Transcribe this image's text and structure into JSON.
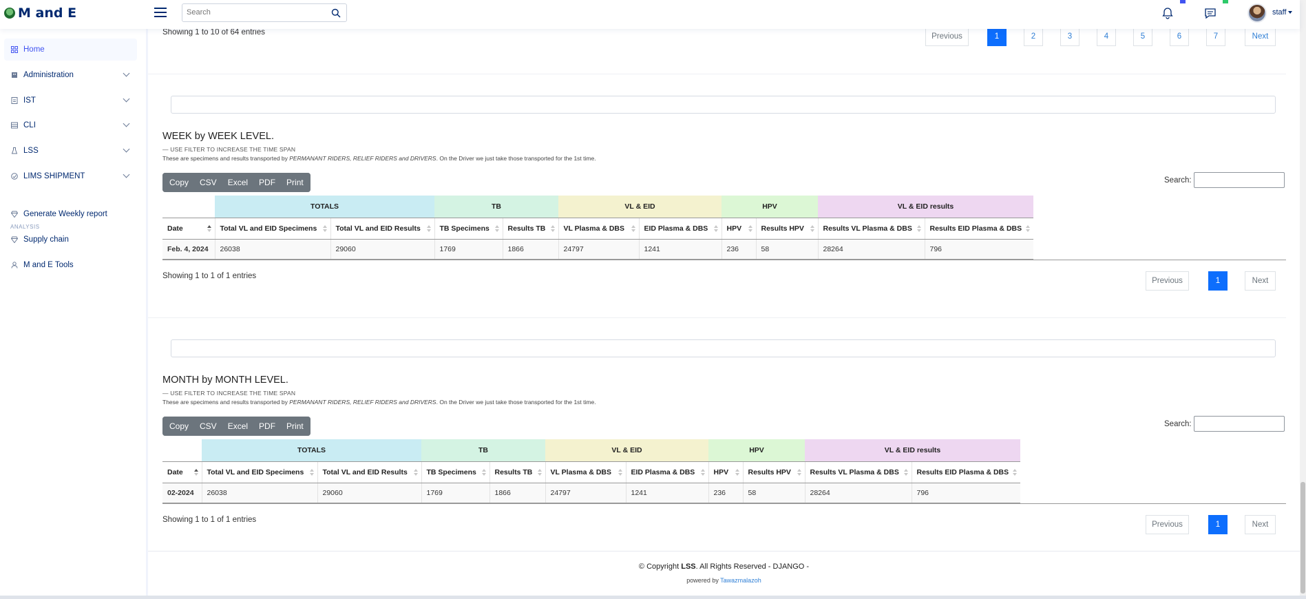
{
  "app": {
    "title": "M and E"
  },
  "header": {
    "search_placeholder": "Search",
    "user": "staff"
  },
  "sidebar": {
    "items": [
      {
        "label": "Home",
        "icon": "grid-icon"
      },
      {
        "label": "Administration",
        "icon": "building-icon"
      },
      {
        "label": "IST",
        "icon": "document-icon"
      },
      {
        "label": "CLI",
        "icon": "list-icon"
      },
      {
        "label": "LSS",
        "icon": "flask-icon"
      },
      {
        "label": "LIMS SHIPMENT",
        "icon": "shipment-icon"
      }
    ],
    "heading": "ANALYSIS",
    "analysis_items": [
      {
        "label": "Generate Weekly report",
        "icon": "gem-icon"
      },
      {
        "label": "Supply chain",
        "icon": "gem-icon"
      },
      {
        "label": "M and E Tools",
        "icon": "person-icon"
      }
    ]
  },
  "top_pager": {
    "info": "Showing 1 to 10 of 64 entries",
    "previous": "Previous",
    "next": "Next",
    "pages": [
      "1",
      "2",
      "3",
      "4",
      "5",
      "6",
      "7"
    ]
  },
  "common": {
    "subtitle": "— USE FILTER TO INCREASE THE TIME SPAN",
    "desc_start": "These are specimens and results transported by ",
    "desc_em": "PERMANANT RIDERS, RELIEF RIDERS and DRIVERS",
    "desc_end": ". On the Driver we just take those transported for the 1st time.",
    "buttons": [
      "Copy",
      "CSV",
      "Excel",
      "PDF",
      "Print"
    ],
    "search_label": "Search:",
    "previous": "Previous",
    "next": "Next",
    "groups": [
      "TOTALS",
      "TB",
      "VL & EID",
      "HPV",
      "VL & EID results"
    ],
    "columns": [
      "Date",
      "Total VL and EID Specimens",
      "Total VL and EID Results",
      "TB Specimens",
      "Results TB",
      "VL Plasma & DBS",
      "EID Plasma & DBS",
      "HPV",
      "Results HPV",
      "Results VL Plasma & DBS",
      "Results EID Plasma & DBS"
    ]
  },
  "week": {
    "title": "WEEK by WEEK LEVEL.",
    "rows": [
      [
        "Feb. 4, 2024",
        "26038",
        "29060",
        "1769",
        "1866",
        "24797",
        "1241",
        "236",
        "58",
        "28264",
        "796"
      ]
    ],
    "info": "Showing 1 to 1 of 1 entries",
    "page": "1"
  },
  "month": {
    "title": "MONTH by MONTH LEVEL.",
    "rows": [
      [
        "02-2024",
        "26038",
        "29060",
        "1769",
        "1866",
        "24797",
        "1241",
        "236",
        "58",
        "28264",
        "796"
      ]
    ],
    "info": "Showing 1 to 1 of 1 entries",
    "page": "1"
  },
  "footer": {
    "copy_pre": "© Copyright ",
    "brand": "LSS",
    "copy_post": ". All Rights Reserved - DJANGO -",
    "powered": "powered by ",
    "author": "Tawazmalazoh"
  }
}
